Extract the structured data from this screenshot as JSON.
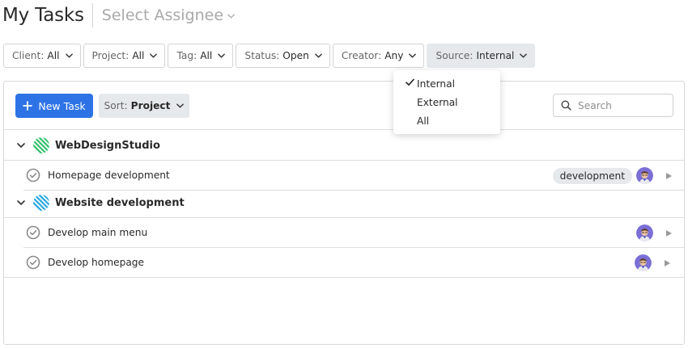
{
  "header": {
    "title": "My Tasks",
    "assignee_label": "Select Assignee"
  },
  "filters": [
    {
      "label": "Client:",
      "value": "All"
    },
    {
      "label": "Project:",
      "value": "All"
    },
    {
      "label": "Tag:",
      "value": "All"
    },
    {
      "label": "Status:",
      "value": "Open"
    },
    {
      "label": "Creator:",
      "value": "Any"
    },
    {
      "label": "Source:",
      "value": "Internal"
    }
  ],
  "toolbar": {
    "new_task_label": "New Task",
    "sort_label": "Sort:",
    "sort_value": "Project",
    "search_placeholder": "Search"
  },
  "source_dropdown": {
    "options": [
      "Internal",
      "External",
      "All"
    ],
    "selected": "Internal"
  },
  "groups": [
    {
      "name": "WebDesignStudio",
      "icon_color": "#2fbf6a",
      "tasks": [
        {
          "name": "Homepage development",
          "tag": "development"
        }
      ]
    },
    {
      "name": "Website development",
      "icon_color": "#27a8e0",
      "tasks": [
        {
          "name": "Develop main menu",
          "tag": ""
        },
        {
          "name": "Develop homepage",
          "tag": ""
        }
      ]
    }
  ],
  "colors": {
    "accent": "#2d73e6",
    "avatar_bg": "#7b6fd6"
  }
}
